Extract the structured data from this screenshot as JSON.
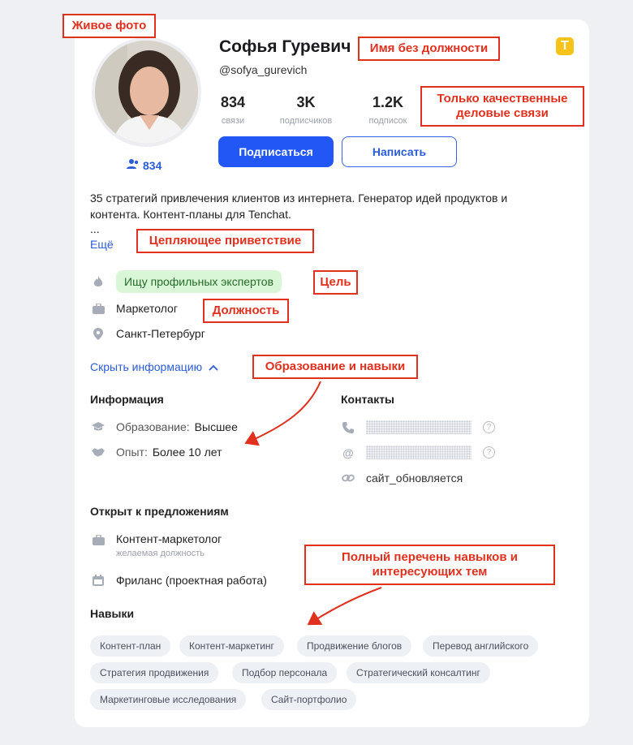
{
  "profile": {
    "name": "Софья Гуревич",
    "handle": "@sofya_gurevich",
    "connections_small": "834",
    "stats": [
      {
        "value": "834",
        "label": "связи"
      },
      {
        "value": "3K",
        "label": "подписчиков"
      },
      {
        "value": "1.2K",
        "label": "подписок"
      }
    ],
    "subscribe_label": "Подписаться",
    "message_label": "Написать",
    "logo_letter": "T"
  },
  "bio": {
    "text": "35 стратегий привлечения клиентов из интернета. Генератор идей продуктов и контента. Контент-планы для Tenchat.",
    "ellipsis": "...",
    "more_label": "Ещё"
  },
  "details": {
    "goal": "Ищу профильных экспертов",
    "position": "Маркетолог",
    "city": "Санкт-Петербург"
  },
  "toggle_label": "Скрыть информацию",
  "info": {
    "title": "Информация",
    "education_label": "Образование:",
    "education_value": "Высшее",
    "experience_label": "Опыт:",
    "experience_value": "Более 10 лет"
  },
  "contacts": {
    "title": "Контакты",
    "site": "сайт_обновляется"
  },
  "offers": {
    "title": "Открыт к предложениям",
    "role": "Контент-маркетолог",
    "role_sub": "желаемая должность",
    "format": "Фриланс (проектная работа)"
  },
  "skills": {
    "title": "Навыки",
    "items": [
      "Контент-план",
      "Контент-маркетинг",
      "Продвижение блогов",
      "Перевод английского",
      "Стратегия продвижения",
      "Подбор персонала",
      "Стратегический консалтинг",
      "Маркетинговые исследования",
      "Сайт-портфолио"
    ]
  },
  "annotations": {
    "live_photo": "Живое фото",
    "name_no_position": "Имя без должности",
    "quality_connections": "Только качественные деловые связи",
    "greeting": "Цепляющее приветствие",
    "goal": "Цель",
    "position": "Должность",
    "education_skills": "Образование и навыки",
    "skills_list": "Полный перечень навыков и интересующих тем"
  },
  "colors": {
    "accent": "#2257f5",
    "annotation": "#e0301e",
    "goal_bg": "#d9f7d6"
  }
}
